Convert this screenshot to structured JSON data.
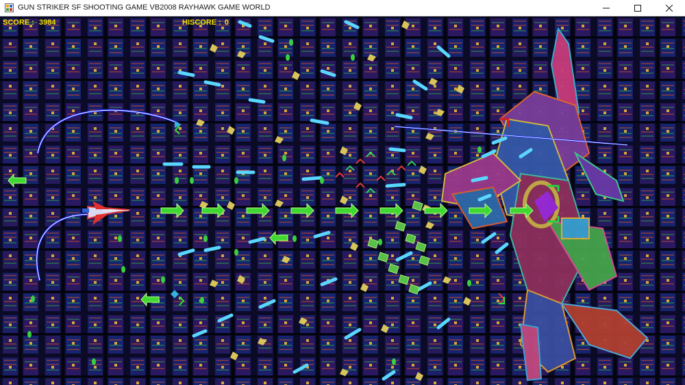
{
  "window": {
    "title": "GUN STRIKER SF SHOOTING GAME VB2008 RAYHAWK GAME WORLD",
    "icon": "app-window-icon",
    "controls": [
      "minimize",
      "maximize",
      "close"
    ]
  },
  "hud": {
    "score_label": "SCORE",
    "score_value": "3984",
    "hiscore_label": "HISCORE",
    "hiscore_value": "0",
    "color": "#f4e100"
  },
  "scene": {
    "background": "tiled-circuit-pattern",
    "player": "red-white-fighter-ship",
    "boss": "giant-mecha-robot",
    "colors": {
      "background": "#07071a",
      "laser": "#1c2cff",
      "player_bullet": "#40d830",
      "enemy_bullet": "#5ad7ff",
      "debris": "#d8c45a"
    }
  }
}
